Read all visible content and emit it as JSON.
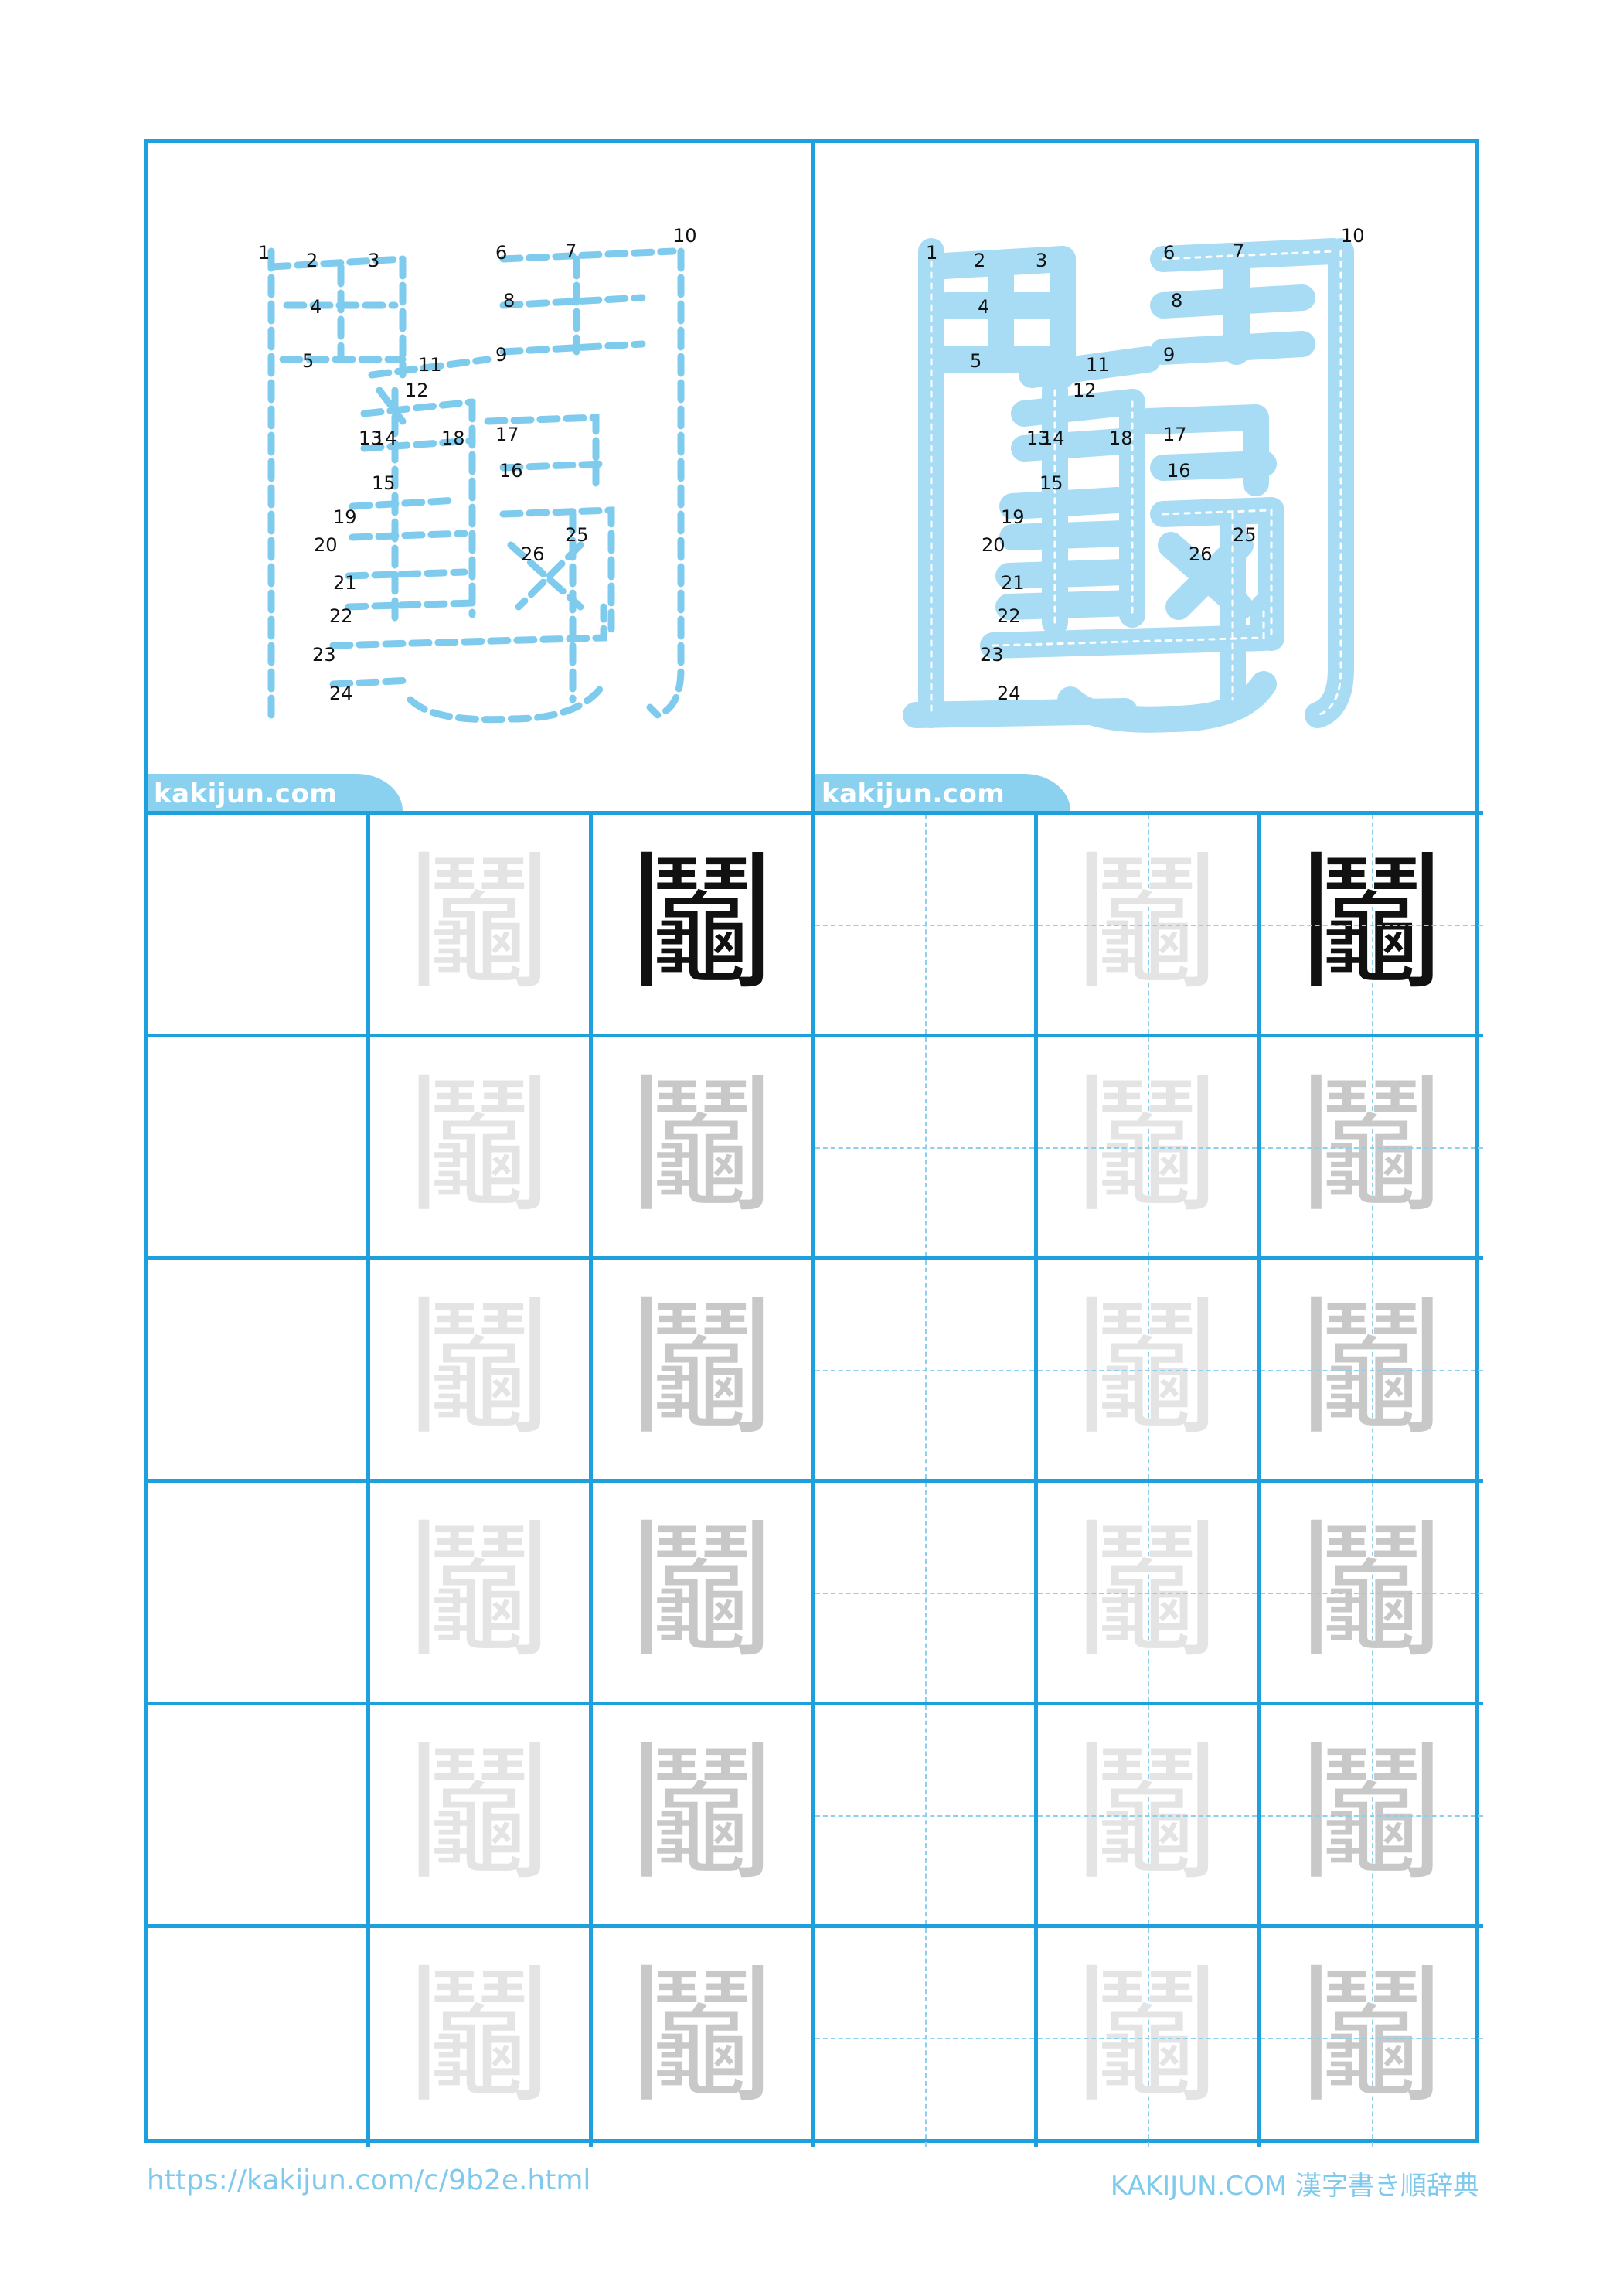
{
  "kanji": "鬮",
  "brand": "kakijun.com",
  "footer": {
    "url": "https://kakijun.com/c/9b2e.html",
    "site": "KAKIJUN.COM 漢字書き順辞典"
  },
  "stroke_numbers": [
    "1",
    "2",
    "3",
    "4",
    "5",
    "6",
    "7",
    "8",
    "9",
    "10",
    "11",
    "12",
    "13",
    "14",
    "15",
    "16",
    "17",
    "18",
    "19",
    "20",
    "21",
    "22",
    "23",
    "24",
    "25",
    "26"
  ],
  "colors": {
    "grid": "#1ea0dc",
    "dashed_stroke": "#7fcbee",
    "solid_stroke": "#a7dcf4"
  }
}
